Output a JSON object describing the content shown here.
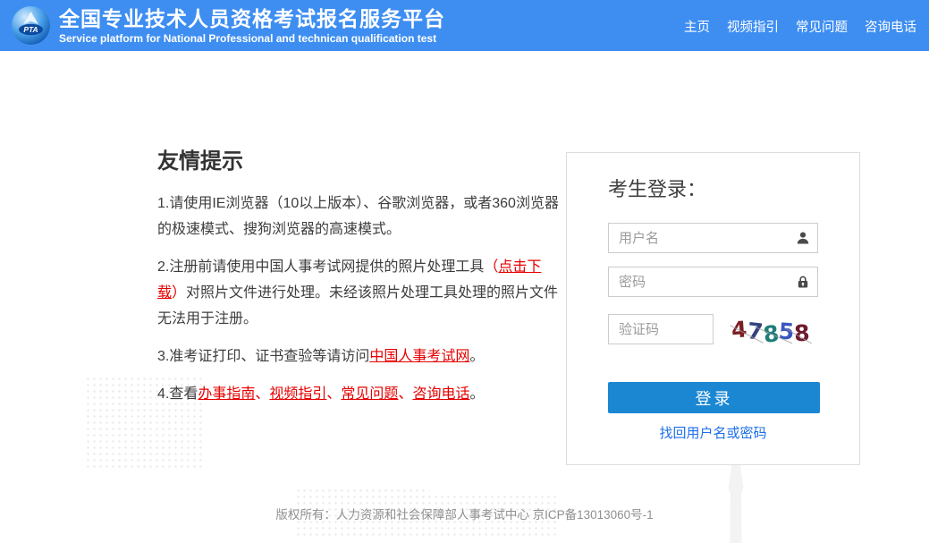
{
  "header": {
    "logo_text": "PTA",
    "title": "全国专业技术人员资格考试报名服务平台",
    "subtitle": "Service platform for National Professional and technican qualification test",
    "bg_color": "#3e8ef2",
    "nav": [
      {
        "label": "主页"
      },
      {
        "label": "视频指引"
      },
      {
        "label": "常见问题"
      },
      {
        "label": "咨询电话"
      }
    ]
  },
  "tips": {
    "heading": "友情提示",
    "item1": "1.请使用IE浏览器（10以上版本）、谷歌浏览器，或者360浏览器的极速模式、搜狗浏览器的高速模式。",
    "item2_pre": "2.注册前请使用中国人事考试网提供的照片处理工具",
    "item2_paren_open": "（",
    "item2_link": "点击下载",
    "item2_paren_close": "）",
    "item2_post": "对照片文件进行处理。未经该照片处理工具处理的照片文件无法用于注册。",
    "item3_pre": "3.准考证打印、证书查验等请访问",
    "item3_link": "中国人事考试网",
    "item3_post": "。",
    "item4_pre": "4.查看",
    "item4_links": [
      "办事指南",
      "视频指引",
      "常见问题",
      "咨询电话"
    ],
    "item4_sep": "、",
    "item4_post": "。",
    "link_color": "#e60000"
  },
  "login": {
    "heading": "考生登录：",
    "username_placeholder": "用户名",
    "password_placeholder": "密码",
    "captcha_placeholder": "验证码",
    "captcha_value": "47858",
    "captcha_digits": [
      "4",
      "7",
      "8",
      "5",
      "8"
    ],
    "captcha_digit_colors": [
      "#7b1f24",
      "#33427e",
      "#1f7d78",
      "#3a56c0",
      "#6e1a2e"
    ],
    "login_button": "登录",
    "forgot_link": "找回用户名或密码",
    "button_color": "#1b87d3",
    "forgot_color": "#1d6fe8"
  },
  "footer": {
    "copyright": "版权所有：人力资源和社会保障部人事考试中心 京ICP备13013060号-1"
  }
}
